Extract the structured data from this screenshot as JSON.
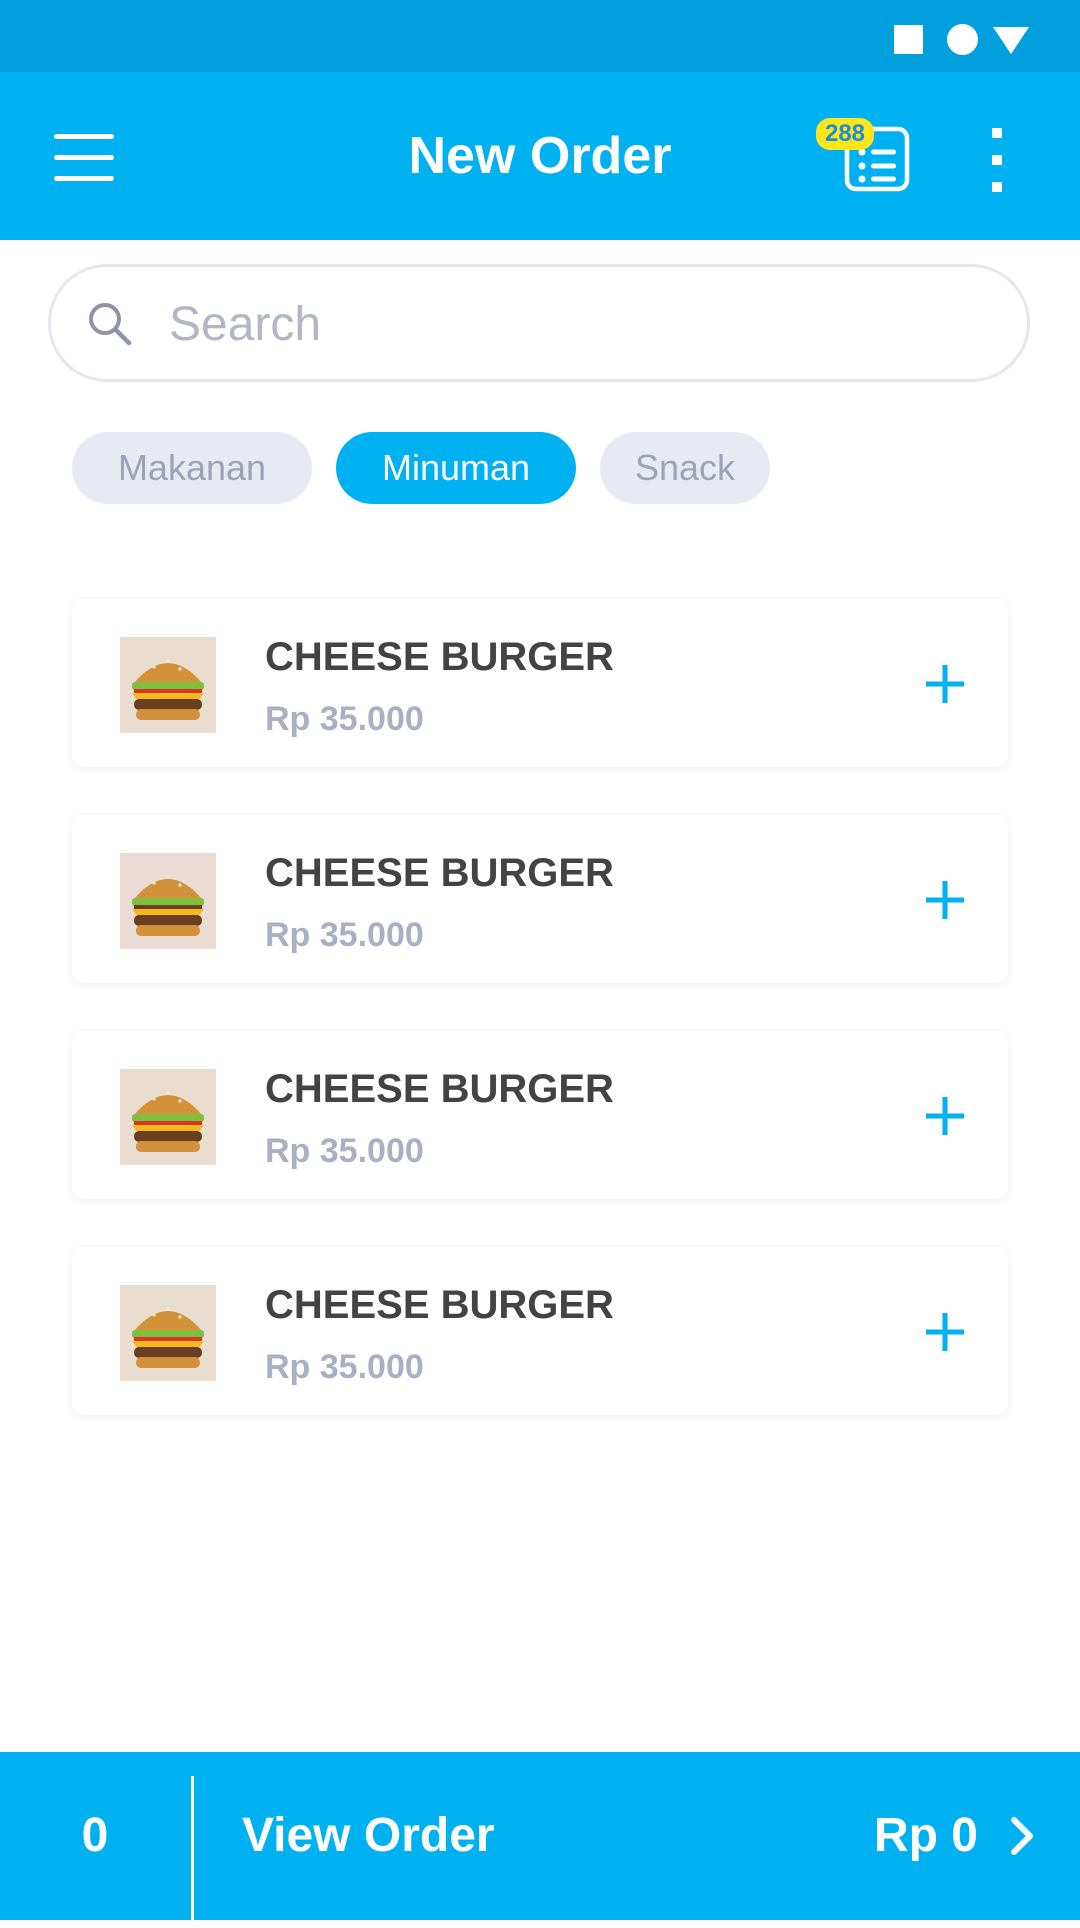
{
  "app_bar": {
    "title": "New Order",
    "orders_badge": "288",
    "menu_icon": "hamburger-menu-icon",
    "orders_icon": "order-list-icon",
    "more_icon": "more-vertical-icon",
    "background_color": "#00b1f2"
  },
  "status_bar": {
    "icons": [
      "square-icon",
      "circle-icon",
      "triangle-icon"
    ],
    "background_color": "#00a0de"
  },
  "search": {
    "value": "",
    "placeholder": "Search",
    "icon": "search-icon"
  },
  "categories": [
    {
      "label": "Makanan",
      "selected": false
    },
    {
      "label": "Minuman",
      "selected": true
    },
    {
      "label": "Snack",
      "selected": false
    }
  ],
  "products": [
    {
      "name": "CHEESE BURGER",
      "price": "Rp 35.000",
      "image": "cheese-burger-image"
    },
    {
      "name": "CHEESE BURGER",
      "price": "Rp 35.000",
      "image": "cheese-burger-image"
    },
    {
      "name": "CHEESE BURGER",
      "price": "Rp 35.000",
      "image": "cheese-burger-image"
    },
    {
      "name": "CHEESE BURGER",
      "price": "Rp 35.000",
      "image": "cheese-burger-image"
    }
  ],
  "bottom_bar": {
    "count": "0",
    "label": "View Order",
    "total": "Rp 0"
  },
  "colors": {
    "accent": "#00b1f2",
    "product_name": "#434343",
    "price": "#aab0c3",
    "chip_inactive_bg": "#e8eaf3",
    "badge": "#ffe51a"
  }
}
